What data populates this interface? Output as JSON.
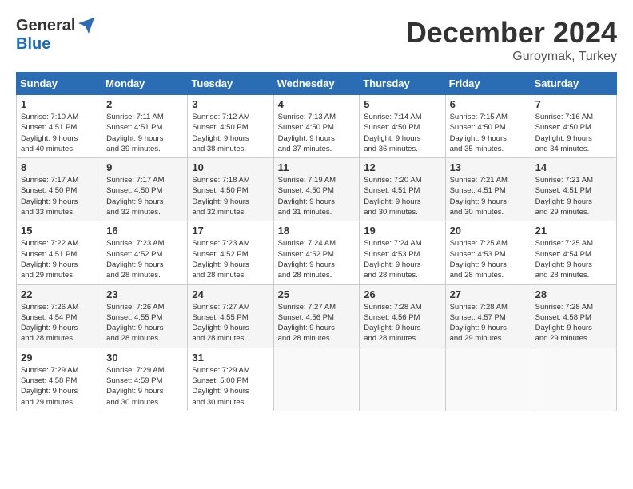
{
  "logo": {
    "general": "General",
    "blue": "Blue"
  },
  "title": "December 2024",
  "subtitle": "Guroymak, Turkey",
  "days_header": [
    "Sunday",
    "Monday",
    "Tuesday",
    "Wednesday",
    "Thursday",
    "Friday",
    "Saturday"
  ],
  "weeks": [
    [
      {
        "day": "1",
        "sunrise": "7:10 AM",
        "sunset": "4:51 PM",
        "daylight": "9 hours and 40 minutes."
      },
      {
        "day": "2",
        "sunrise": "7:11 AM",
        "sunset": "4:51 PM",
        "daylight": "9 hours and 39 minutes."
      },
      {
        "day": "3",
        "sunrise": "7:12 AM",
        "sunset": "4:50 PM",
        "daylight": "9 hours and 38 minutes."
      },
      {
        "day": "4",
        "sunrise": "7:13 AM",
        "sunset": "4:50 PM",
        "daylight": "9 hours and 37 minutes."
      },
      {
        "day": "5",
        "sunrise": "7:14 AM",
        "sunset": "4:50 PM",
        "daylight": "9 hours and 36 minutes."
      },
      {
        "day": "6",
        "sunrise": "7:15 AM",
        "sunset": "4:50 PM",
        "daylight": "9 hours and 35 minutes."
      },
      {
        "day": "7",
        "sunrise": "7:16 AM",
        "sunset": "4:50 PM",
        "daylight": "9 hours and 34 minutes."
      }
    ],
    [
      {
        "day": "8",
        "sunrise": "7:17 AM",
        "sunset": "4:50 PM",
        "daylight": "9 hours and 33 minutes."
      },
      {
        "day": "9",
        "sunrise": "7:17 AM",
        "sunset": "4:50 PM",
        "daylight": "9 hours and 32 minutes."
      },
      {
        "day": "10",
        "sunrise": "7:18 AM",
        "sunset": "4:50 PM",
        "daylight": "9 hours and 32 minutes."
      },
      {
        "day": "11",
        "sunrise": "7:19 AM",
        "sunset": "4:50 PM",
        "daylight": "9 hours and 31 minutes."
      },
      {
        "day": "12",
        "sunrise": "7:20 AM",
        "sunset": "4:51 PM",
        "daylight": "9 hours and 30 minutes."
      },
      {
        "day": "13",
        "sunrise": "7:21 AM",
        "sunset": "4:51 PM",
        "daylight": "9 hours and 30 minutes."
      },
      {
        "day": "14",
        "sunrise": "7:21 AM",
        "sunset": "4:51 PM",
        "daylight": "9 hours and 29 minutes."
      }
    ],
    [
      {
        "day": "15",
        "sunrise": "7:22 AM",
        "sunset": "4:51 PM",
        "daylight": "9 hours and 29 minutes."
      },
      {
        "day": "16",
        "sunrise": "7:23 AM",
        "sunset": "4:52 PM",
        "daylight": "9 hours and 28 minutes."
      },
      {
        "day": "17",
        "sunrise": "7:23 AM",
        "sunset": "4:52 PM",
        "daylight": "9 hours and 28 minutes."
      },
      {
        "day": "18",
        "sunrise": "7:24 AM",
        "sunset": "4:52 PM",
        "daylight": "9 hours and 28 minutes."
      },
      {
        "day": "19",
        "sunrise": "7:24 AM",
        "sunset": "4:53 PM",
        "daylight": "9 hours and 28 minutes."
      },
      {
        "day": "20",
        "sunrise": "7:25 AM",
        "sunset": "4:53 PM",
        "daylight": "9 hours and 28 minutes."
      },
      {
        "day": "21",
        "sunrise": "7:25 AM",
        "sunset": "4:54 PM",
        "daylight": "9 hours and 28 minutes."
      }
    ],
    [
      {
        "day": "22",
        "sunrise": "7:26 AM",
        "sunset": "4:54 PM",
        "daylight": "9 hours and 28 minutes."
      },
      {
        "day": "23",
        "sunrise": "7:26 AM",
        "sunset": "4:55 PM",
        "daylight": "9 hours and 28 minutes."
      },
      {
        "day": "24",
        "sunrise": "7:27 AM",
        "sunset": "4:55 PM",
        "daylight": "9 hours and 28 minutes."
      },
      {
        "day": "25",
        "sunrise": "7:27 AM",
        "sunset": "4:56 PM",
        "daylight": "9 hours and 28 minutes."
      },
      {
        "day": "26",
        "sunrise": "7:28 AM",
        "sunset": "4:56 PM",
        "daylight": "9 hours and 28 minutes."
      },
      {
        "day": "27",
        "sunrise": "7:28 AM",
        "sunset": "4:57 PM",
        "daylight": "9 hours and 29 minutes."
      },
      {
        "day": "28",
        "sunrise": "7:28 AM",
        "sunset": "4:58 PM",
        "daylight": "9 hours and 29 minutes."
      }
    ],
    [
      {
        "day": "29",
        "sunrise": "7:29 AM",
        "sunset": "4:58 PM",
        "daylight": "9 hours and 29 minutes."
      },
      {
        "day": "30",
        "sunrise": "7:29 AM",
        "sunset": "4:59 PM",
        "daylight": "9 hours and 30 minutes."
      },
      {
        "day": "31",
        "sunrise": "7:29 AM",
        "sunset": "5:00 PM",
        "daylight": "9 hours and 30 minutes."
      },
      null,
      null,
      null,
      null
    ]
  ],
  "labels": {
    "sunrise": "Sunrise:",
    "sunset": "Sunset:",
    "daylight": "Daylight:"
  }
}
